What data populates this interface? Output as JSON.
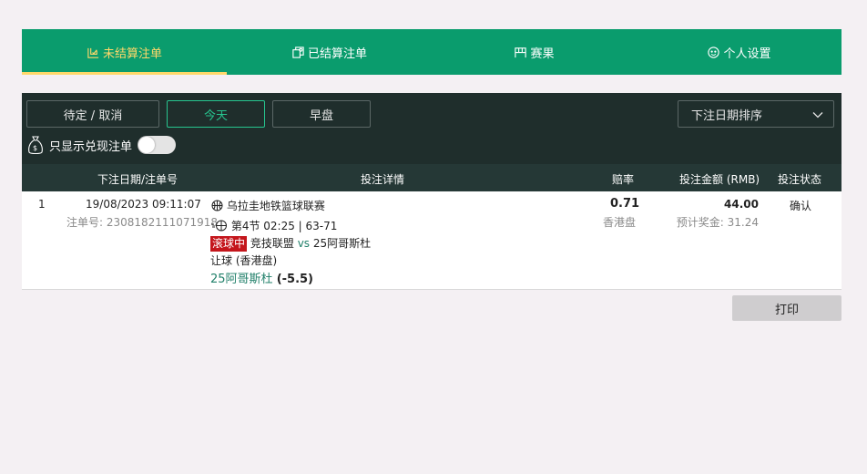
{
  "tabs": [
    {
      "label": "未结算注单",
      "icon": "unsettled-icon",
      "active": true
    },
    {
      "label": "已结算注单",
      "icon": "settled-icon",
      "active": false
    },
    {
      "label": "赛果",
      "icon": "results-icon",
      "active": false
    },
    {
      "label": "个人设置",
      "icon": "settings-icon",
      "active": false
    }
  ],
  "filters": {
    "pending_cancel": "待定 / 取消",
    "today": "今天",
    "early": "早盘",
    "sort_select": "下注日期排序",
    "cashout_only": "只显示兑现注单"
  },
  "table": {
    "headers": {
      "date_betno": "下注日期/注单号",
      "details": "投注详情",
      "odds": "赔率",
      "amount": "投注金额 (RMB)",
      "status": "投注状态"
    },
    "rows": [
      {
        "index": "1",
        "datetime": "19/08/2023 09:11:07",
        "bet_no": "注单号: 2308182111071918",
        "league": "乌拉圭地铁篮球联赛",
        "period_score": "第4节 02:25 | 63-71",
        "live_badge": "滚球中",
        "home": "竞技联盟",
        "vs": "vs",
        "away": "25阿哥斯杜",
        "market": "让球 (香港盘)",
        "selection": "25阿哥斯杜",
        "handicap": "(-5.5)",
        "odds": "0.71",
        "odds_type": "香港盘",
        "stake": "44.00",
        "est_payout": "预计奖金: 31.24",
        "status": "确认"
      }
    ]
  },
  "print_label": "打印",
  "colors": {
    "primary_green": "#0a9c6d",
    "active_yellow": "#ffd86a",
    "filter_bg": "#1f2e2c",
    "live_red": "#c4161c"
  }
}
